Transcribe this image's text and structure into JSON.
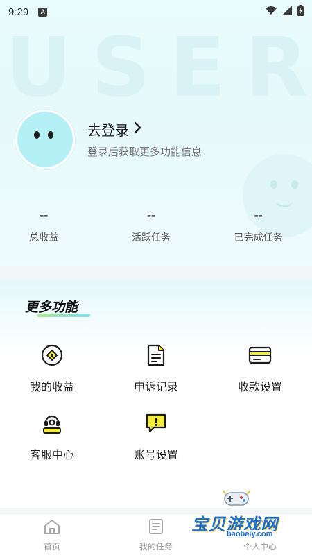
{
  "status_bar": {
    "time": "9:29",
    "notif_badge": "A"
  },
  "header": {
    "watermark": "USER",
    "login_label": "去登录",
    "login_sub": "登录后获取更多功能信息"
  },
  "stats": [
    {
      "value": "--",
      "label": "总收益"
    },
    {
      "value": "--",
      "label": "活跃任务"
    },
    {
      "value": "--",
      "label": "已完成任务"
    }
  ],
  "features": {
    "title": "更多功能",
    "items": [
      {
        "label": "我的收益",
        "icon": "coin-circle-icon"
      },
      {
        "label": "申诉记录",
        "icon": "document-icon"
      },
      {
        "label": "收款设置",
        "icon": "card-icon"
      },
      {
        "label": "客服中心",
        "icon": "headset-icon"
      },
      {
        "label": "账号设置",
        "icon": "alert-bubble-icon"
      }
    ]
  },
  "bottom_nav": [
    {
      "label": "首页",
      "icon": "home-icon"
    },
    {
      "label": "我的任务",
      "icon": "task-list-icon"
    },
    {
      "label": "个人中心",
      "icon": "user-icon"
    }
  ],
  "site_watermark": {
    "name": "宝贝游戏网",
    "url": "baobeiy.com"
  },
  "colors": {
    "accent": "#2ec4d6",
    "icon_dark": "#1c1c1c",
    "highlight_yellow": "#f2ec3b"
  }
}
